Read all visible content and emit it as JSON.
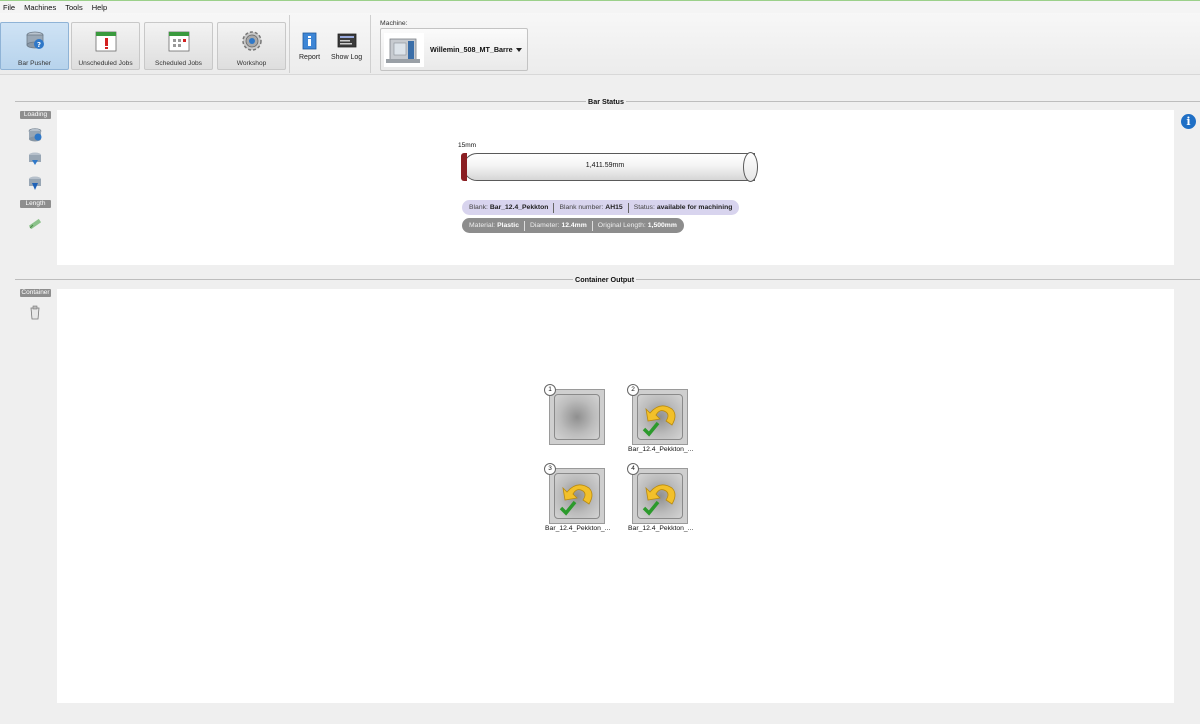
{
  "menu": [
    "File",
    "Machines",
    "Tools",
    "Help"
  ],
  "ribbon": {
    "buttons": [
      {
        "label": "Bar Pusher",
        "icon": "bar-pusher-icon",
        "active": true
      },
      {
        "label": "Unscheduled Jobs",
        "icon": "calendar-alert-icon"
      },
      {
        "label": "Scheduled Jobs",
        "icon": "calendar-schedule-icon"
      },
      {
        "label": "Workshop",
        "icon": "gear-icon"
      }
    ],
    "report_label": "Report",
    "showlog_label": "Show Log",
    "machine_label": "Machine:",
    "machine_value": "Willemin_508_MT_Barre"
  },
  "bar_status": {
    "title": "Bar Status",
    "tools": {
      "loading_label": "Loading",
      "length_label": "Length"
    },
    "cut_label": "15mm",
    "length_label": "1,411.59mm",
    "info_line1": {
      "blank_key": "Blank:",
      "blank_val": "Bar_12.4_Pekkton",
      "number_key": "Blank number:",
      "number_val": "AH15",
      "status_key": "Status:",
      "status_val": "available for machining"
    },
    "info_line2": {
      "material_key": "Material:",
      "material_val": "Plastic",
      "diameter_key": "Diameter:",
      "diameter_val": "12.4mm",
      "origlen_key": "Original Length:",
      "origlen_val": "1,500mm"
    }
  },
  "container_output": {
    "title": "Container Output",
    "tool_label": "Container",
    "slots": [
      {
        "num": "1",
        "caption": ""
      },
      {
        "num": "2",
        "caption": "Bar_12.4_Pekkton_..."
      },
      {
        "num": "3",
        "caption": "Bar_12.4_Pekkton_..."
      },
      {
        "num": "4",
        "caption": "Bar_12.4_Pekkton_..."
      }
    ]
  },
  "colors": {
    "accent_blue": "#1f6fc5",
    "bar_cut_red": "#8a1e22",
    "status_pill": "#d8d4ee"
  }
}
